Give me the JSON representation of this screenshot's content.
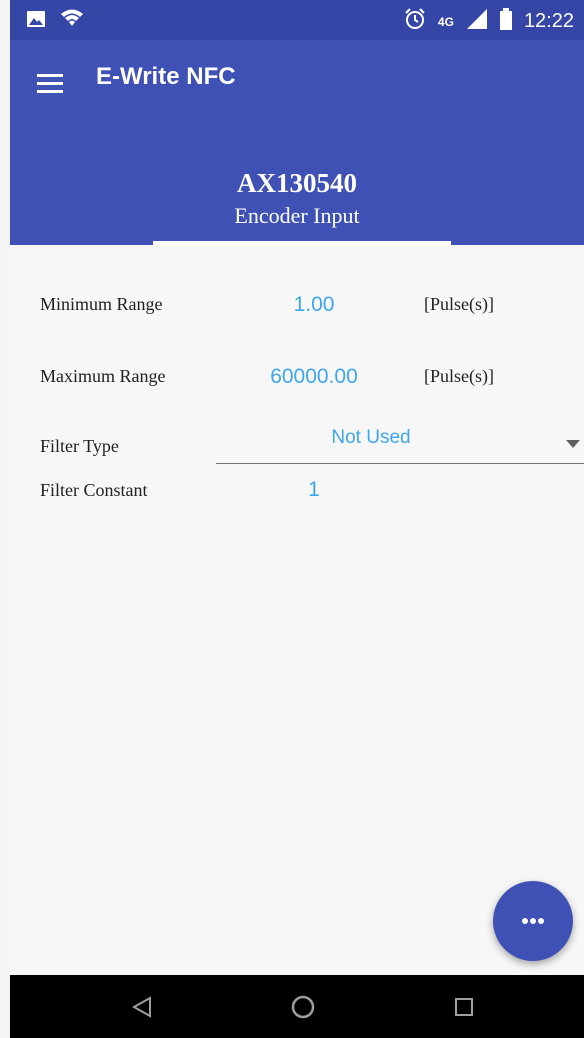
{
  "status_bar": {
    "time": "12:22",
    "network": "4G",
    "icons": [
      "image-icon",
      "wifi-icon",
      "alarm-icon",
      "signal-icon",
      "battery-icon"
    ]
  },
  "app_bar": {
    "title": "E-Write NFC",
    "menu_icon": "menu-icon",
    "device_id": "AX130540",
    "subtitle": "Encoder Input"
  },
  "fields": {
    "minimum_range": {
      "label": "Minimum Range",
      "value": "1.00",
      "unit": "[Pulse(s)]"
    },
    "maximum_range": {
      "label": "Maximum Range",
      "value": "60000.00",
      "unit": "[Pulse(s)]"
    },
    "filter_type": {
      "label": "Filter Type",
      "value": "Not Used"
    },
    "filter_constant": {
      "label": "Filter Constant",
      "value": "1"
    }
  },
  "fab": {
    "icon": "more-horiz-icon"
  },
  "nav_bar": {
    "icons": [
      "back-icon",
      "home-icon",
      "recents-icon"
    ]
  },
  "colors": {
    "primary": "#3f51b5",
    "primary_dark": "#3646a6",
    "value_text": "#3ea6ea",
    "background": "#f7f7f7"
  }
}
